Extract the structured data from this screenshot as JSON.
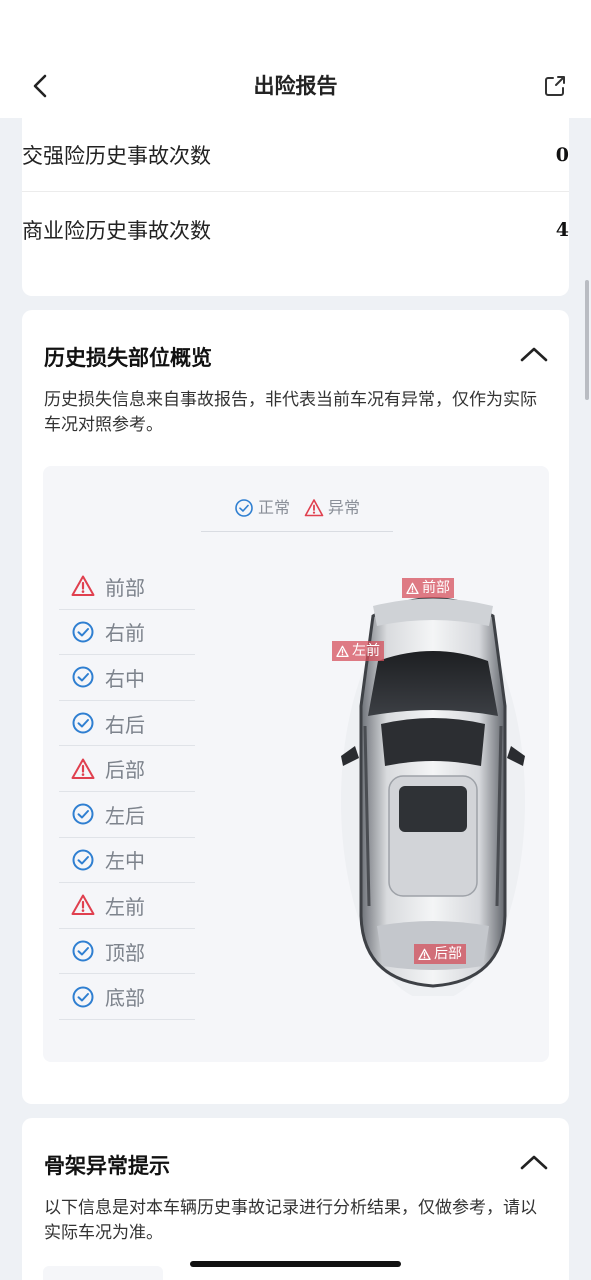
{
  "header": {
    "title": "出险报告",
    "back_icon": "chevron-left-icon",
    "share_icon": "share-icon"
  },
  "summary": {
    "rows": [
      {
        "label": "交强险历史事故次数",
        "value": "0"
      },
      {
        "label": "商业险历史事故次数",
        "value": "4"
      }
    ]
  },
  "loss_overview": {
    "title": "历史损失部位概览",
    "description": "历史损失信息来自事故报告，非代表当前车况有异常，仅作为实际车况对照参考。",
    "legend": {
      "normal": "正常",
      "abnormal": "异常"
    },
    "parts": [
      {
        "label": "前部",
        "status": "abnormal"
      },
      {
        "label": "右前",
        "status": "normal"
      },
      {
        "label": "右中",
        "status": "normal"
      },
      {
        "label": "右后",
        "status": "normal"
      },
      {
        "label": "后部",
        "status": "abnormal"
      },
      {
        "label": "左后",
        "status": "normal"
      },
      {
        "label": "左中",
        "status": "normal"
      },
      {
        "label": "左前",
        "status": "abnormal"
      },
      {
        "label": "顶部",
        "status": "normal"
      },
      {
        "label": "底部",
        "status": "normal"
      }
    ],
    "car_tags": {
      "front": "前部",
      "left_front": "左前",
      "rear": "后部"
    }
  },
  "frame_alert": {
    "title": "骨架异常提示",
    "description": "以下信息是对本车辆历史事故记录进行分析结果，仅做参考，请以实际车况为准。"
  },
  "colors": {
    "normal": "#2f7fd1",
    "abnormal": "#e0404f",
    "background": "#eef1f5"
  }
}
